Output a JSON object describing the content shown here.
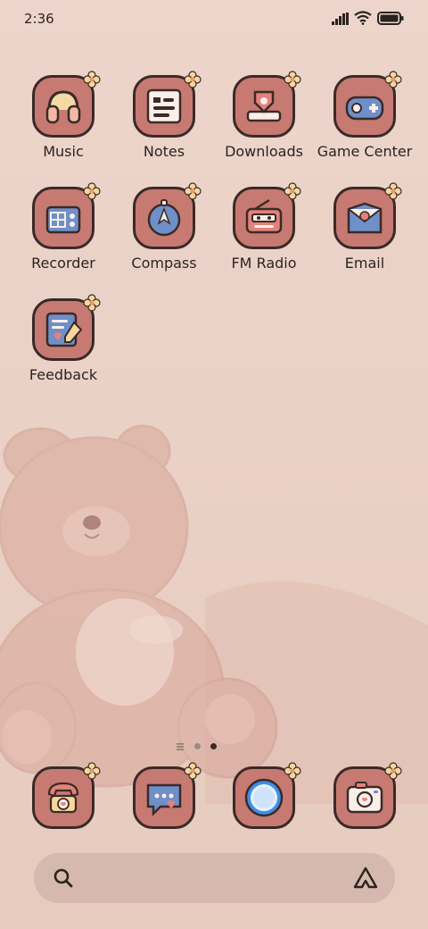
{
  "status": {
    "time": "2:36"
  },
  "apps": [
    {
      "label": "Music",
      "icon": "headphones-icon"
    },
    {
      "label": "Notes",
      "icon": "notes-icon"
    },
    {
      "label": "Downloads",
      "icon": "downloads-icon"
    },
    {
      "label": "Game Center",
      "icon": "gamepad-icon"
    },
    {
      "label": "Recorder",
      "icon": "recorder-icon"
    },
    {
      "label": "Compass",
      "icon": "compass-icon"
    },
    {
      "label": "FM Radio",
      "icon": "radio-icon"
    },
    {
      "label": "Email",
      "icon": "email-icon"
    },
    {
      "label": "Feedback",
      "icon": "feedback-icon"
    }
  ],
  "dock": [
    {
      "icon": "phone-icon"
    },
    {
      "icon": "messages-icon"
    },
    {
      "icon": "browser-icon"
    },
    {
      "icon": "camera-icon"
    }
  ],
  "colors": {
    "tile": "#c77a72",
    "outline": "#3a2a28",
    "background": "#edd5cb",
    "accent_blue": "#6f8fc8"
  }
}
